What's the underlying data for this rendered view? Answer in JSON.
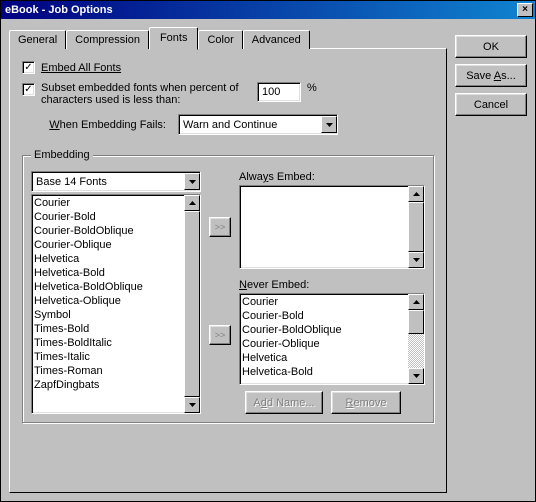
{
  "window": {
    "title": "eBook - Job Options",
    "close": "×"
  },
  "buttons": {
    "ok": "OK",
    "save_as": "Save As...",
    "cancel": "Cancel"
  },
  "tabs": {
    "general": "General",
    "compression": "Compression",
    "fonts": "Fonts",
    "color": "Color",
    "advanced": "Advanced"
  },
  "fonts_panel": {
    "embed_all": "Embed All Fonts",
    "subset_label": "Subset embedded fonts when percent of characters used is less than:",
    "subset_value": "100",
    "percent": "%",
    "when_fails_label": "When Embedding Fails:",
    "when_fails_value": "Warn and Continue",
    "group_label": "Embedding",
    "font_source": "Base 14 Fonts",
    "available_fonts": [
      "Courier",
      "Courier-Bold",
      "Courier-BoldOblique",
      "Courier-Oblique",
      "Helvetica",
      "Helvetica-Bold",
      "Helvetica-BoldOblique",
      "Helvetica-Oblique",
      "Symbol",
      "Times-Bold",
      "Times-BoldItalic",
      "Times-Italic",
      "Times-Roman",
      "ZapfDingbats"
    ],
    "always_embed_label": "Always Embed:",
    "always_embed": [],
    "never_embed_label": "Never Embed:",
    "never_embed": [
      "Courier",
      "Courier-Bold",
      "Courier-BoldOblique",
      "Courier-Oblique",
      "Helvetica",
      "Helvetica-Bold"
    ],
    "move_right": ">>",
    "add_name": "Add Name...",
    "remove": "Remove"
  }
}
